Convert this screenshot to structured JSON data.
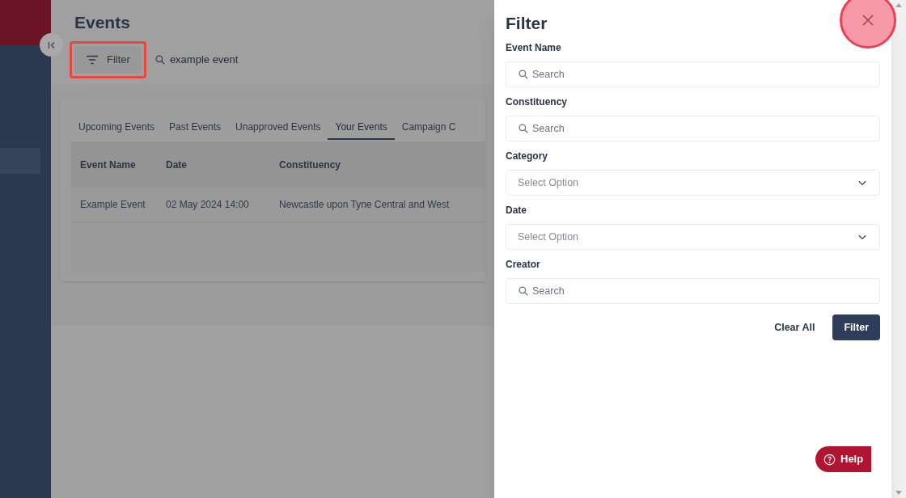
{
  "page": {
    "title": "Events",
    "filter_button": {
      "label": "Filter",
      "highlighted": true
    },
    "search": {
      "value": "example event"
    }
  },
  "tabs": [
    {
      "label": "Upcoming Events",
      "selected": false
    },
    {
      "label": "Past Events",
      "selected": false
    },
    {
      "label": "Unapproved Events",
      "selected": false
    },
    {
      "label": "Your Events",
      "selected": true
    },
    {
      "label": "Campaign C",
      "selected": false
    }
  ],
  "table": {
    "columns": [
      "Event Name",
      "Date",
      "Constituency"
    ],
    "rows": [
      [
        "Example Event",
        "02 May 2024 14:00",
        "Newcastle upon Tyne Central and West"
      ]
    ]
  },
  "filter_panel": {
    "title": "Filter",
    "close_highlighted": true,
    "fields": [
      {
        "label": "Event Name",
        "kind": "search",
        "placeholder": "Search"
      },
      {
        "label": "Constituency",
        "kind": "search",
        "placeholder": "Search"
      },
      {
        "label": "Category",
        "kind": "select",
        "placeholder": "Select Option"
      },
      {
        "label": "Date",
        "kind": "select",
        "placeholder": "Select Option"
      },
      {
        "label": "Creator",
        "kind": "search",
        "placeholder": "Search"
      }
    ],
    "buttons": [
      "Clear All",
      "Filter"
    ]
  },
  "help_button": "Help"
}
